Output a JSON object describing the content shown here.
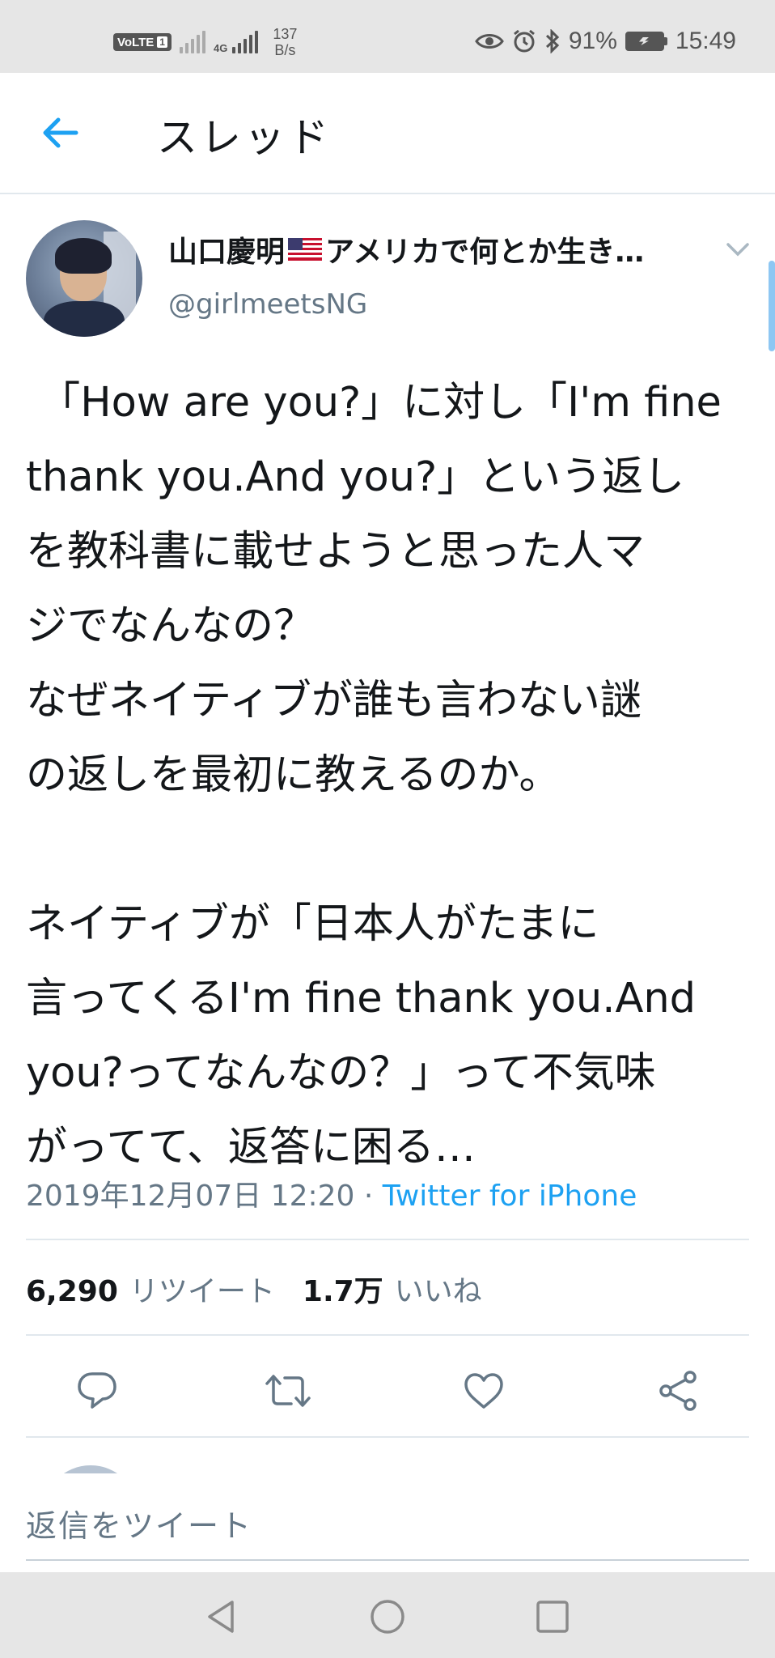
{
  "status_bar": {
    "volte": "VoLTE",
    "sim": "1",
    "network": "4G",
    "speed_value": "137",
    "speed_unit": "B/s",
    "battery": "91%",
    "time": "15:49"
  },
  "header": {
    "title": "スレッド"
  },
  "tweet": {
    "display_name": "山口慶明",
    "display_name_suffix": "アメリカで何とか生き…",
    "handle": "@girlmeetsNG",
    "text": " 「How are you?」に対し「I'm fine\nthank you.And you?」という返し\nを教科書に載せようと思った人マ\nジでなんなの？\nなぜネイティブが誰も言わない謎\nの返しを最初に教えるのか。\n\nネイティブが「日本人がたまに\n言ってくるI'm fine thank you.And\nyou?ってなんなの？」って不気味\nがってて、返答に困る…",
    "datetime": "2019年12月07日 12:20",
    "separator": " · ",
    "source": "Twitter for iPhone",
    "retweets_count": "6,290",
    "retweets_label": "リツイート",
    "likes_count": "1.7万",
    "likes_label": "いいね"
  },
  "actions": {
    "reply": "reply-icon",
    "retweet": "retweet-icon",
    "like": "heart-icon",
    "share": "share-icon"
  },
  "reply_bar": {
    "placeholder": "返信をツイート"
  },
  "colors": {
    "accent": "#1da1f2",
    "secondary_text": "#657786",
    "text": "#14171a"
  }
}
